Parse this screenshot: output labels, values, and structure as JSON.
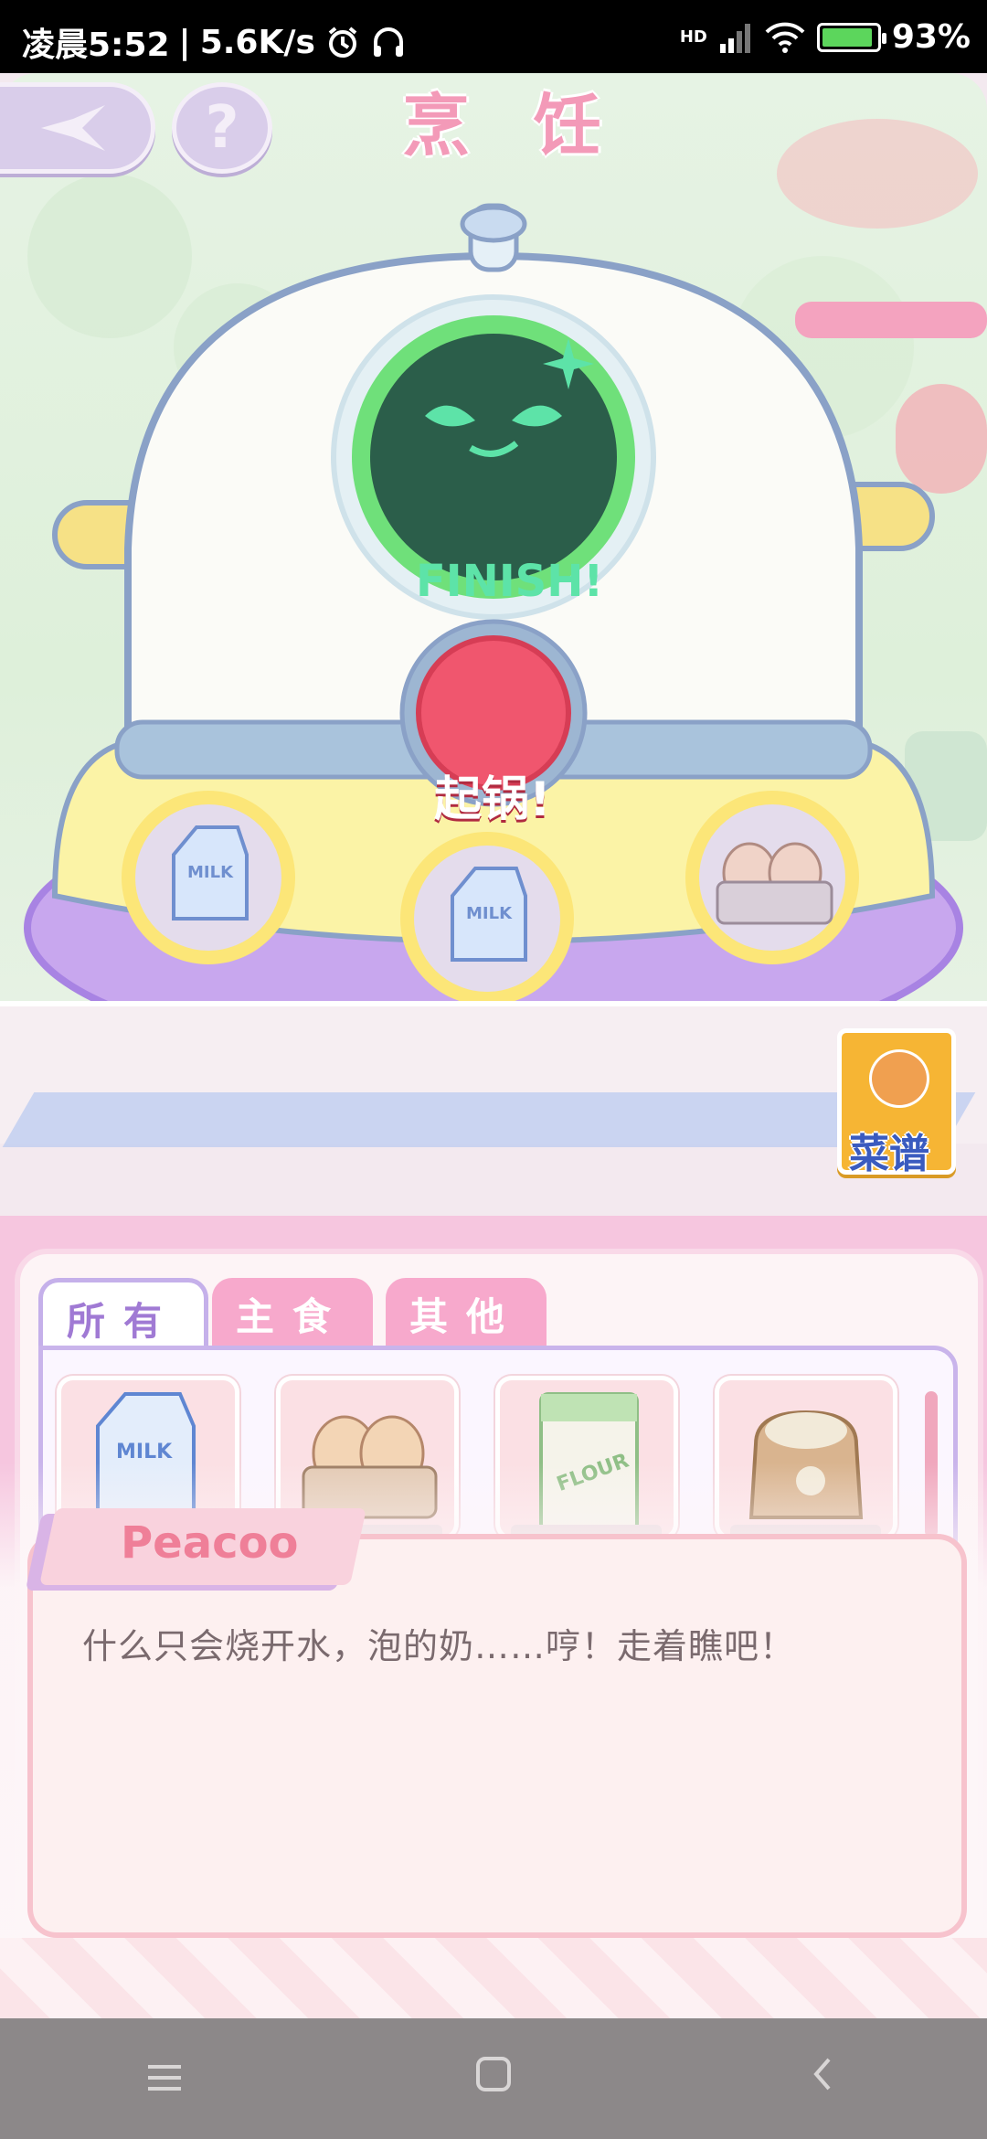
{
  "status_bar": {
    "time": "凌晨5:52",
    "network_speed": "5.6K/s",
    "signal_label": "HD",
    "battery": "93%",
    "battery_level": 0.93
  },
  "game": {
    "title": "烹 饪",
    "help_label": "?",
    "pot_display": "FINISH!",
    "pot_button_label": "起锅!",
    "pot_slots": [
      "milk-carton-icon",
      "milk-carton-icon",
      "egg-tray-icon"
    ],
    "recipe_book_label": "菜谱"
  },
  "inventory": {
    "tabs": [
      {
        "label": "所有",
        "active": true
      },
      {
        "label": "主食",
        "active": false
      },
      {
        "label": "其他",
        "active": false
      }
    ],
    "items": [
      {
        "icon": "milk-carton-icon"
      },
      {
        "icon": "egg-tray-icon"
      },
      {
        "icon": "flour-bag-icon"
      },
      {
        "icon": "rice-sack-icon"
      }
    ]
  },
  "dialog": {
    "speaker": "Peacoo",
    "text": "什么只会烧开水，泡的奶……哼！走着瞧吧！"
  },
  "nav": {
    "menu_icon": "menu-icon",
    "home_icon": "home-icon",
    "back_icon": "back-icon"
  },
  "colors": {
    "title_pink": "#f39ab8",
    "finish_green": "#5de3a8",
    "pot_button_red": "#f0566e",
    "tab_active_text": "#a07ad4",
    "panel_pink": "#f6c6df"
  }
}
